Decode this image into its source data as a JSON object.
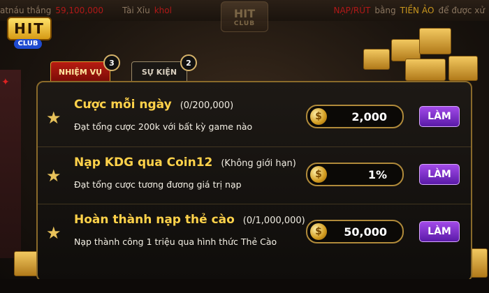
{
  "ticker": {
    "left_fragment": "atnáu thắng",
    "amount": "59,100,000",
    "game": "Tài Xỉu",
    "game_suffix": "khol",
    "nap_rut": "NẠP/RÚT",
    "bang": "bằng",
    "tien_ao": "TIỀN ẢO",
    "tail": "để được xử"
  },
  "logo": {
    "word": "HIT",
    "club": "CLUB"
  },
  "center_logo": {
    "word": "HIT",
    "club": "CLUB"
  },
  "tabs": [
    {
      "label": "NHIỆM VỤ",
      "badge": "3",
      "active": true
    },
    {
      "label": "SỰ KIỆN",
      "badge": "2",
      "active": false
    }
  ],
  "tasks": [
    {
      "title": "Cược mỗi ngày",
      "limit": "(0/200,000)",
      "desc": "Đạt tổng cược 200k với bất kỳ game nào",
      "reward": "2,000",
      "button": "LÀM"
    },
    {
      "title": "Nạp KDG qua Coin12",
      "limit": "(Không giới hạn)",
      "desc": "Đạt tổng cược tương đương giá trị nạp",
      "reward": "1%",
      "button": "LÀM"
    },
    {
      "title": "Hoàn thành nạp thẻ cào",
      "limit": "(0/1,000,000)",
      "desc": "Nạp thành công 1 triệu qua hình thức Thẻ Cào",
      "reward": "50,000",
      "button": "LÀM"
    }
  ],
  "coin_symbol": "$",
  "colors": {
    "accent": "#ffd24a",
    "tab_active": "#b81c12",
    "button": "#7a2ad0",
    "border": "#8a6a2a"
  }
}
